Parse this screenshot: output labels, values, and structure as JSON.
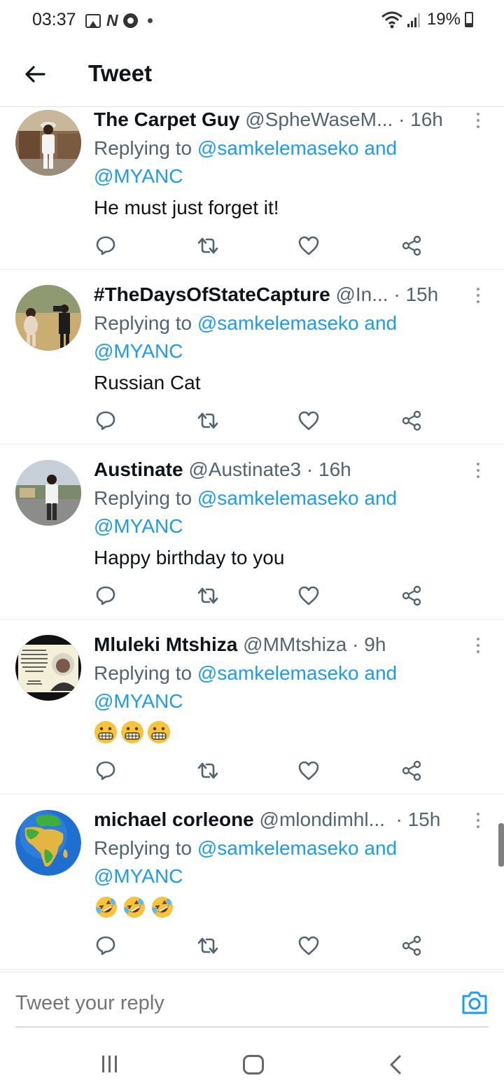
{
  "status_bar": {
    "time": "03:37",
    "battery": "19%",
    "icons_left": [
      "gallery-icon",
      "n-app-icon",
      "chrome-icon",
      "dot-icon"
    ],
    "icons_right": [
      "wifi-icon",
      "signal-icon",
      "battery-icon"
    ]
  },
  "header": {
    "title": "Tweet",
    "back_icon": "arrow-left-icon"
  },
  "colors": {
    "link": "#1d9bf0",
    "text_primary": "#0f1419",
    "text_secondary": "#536471",
    "divider": "#e6ecf0"
  },
  "replies": [
    {
      "name": "The Carpet Guy",
      "handle": "@SpheWaseM...",
      "time": "· 16h",
      "replying_prefix": "Replying to",
      "mention1": "@samkelemaseko",
      "and": "and",
      "mention2": "@MYANC",
      "text": "He must just forget it!",
      "emojis": []
    },
    {
      "name": "#TheDaysOfStateCapture",
      "handle": "@In...",
      "time": "· 15h",
      "replying_prefix": "Replying to",
      "mention1": "@samkelemaseko",
      "and": "and",
      "mention2": "@MYANC",
      "text": "Russian Cat",
      "emojis": []
    },
    {
      "name": "Austinate",
      "handle": "@Austinate3",
      "time": "· 16h",
      "replying_prefix": "Replying to",
      "mention1": "@samkelemaseko",
      "and": "and",
      "mention2": "@MYANC",
      "text": "Happy birthday to you",
      "emojis": []
    },
    {
      "name": "Mluleki Mtshiza",
      "handle": "@MMtshiza",
      "time": "· 9h",
      "replying_prefix": "Replying to",
      "mention1": "@samkelemaseko",
      "and": "and",
      "mention2": "@MYANC",
      "text": "",
      "emojis": [
        "grimacing-face-emoji",
        "grimacing-face-emoji",
        "grimacing-face-emoji"
      ]
    },
    {
      "name": "michael corleone",
      "handle": "@mlondimhl...",
      "time": "· 15h",
      "replying_prefix": "Replying to",
      "mention1": "@samkelemaseko",
      "and": "and",
      "mention2": "@MYANC",
      "text": "",
      "emojis": [
        "rolling-laughing-emoji",
        "rolling-laughing-emoji",
        "rolling-laughing-emoji"
      ]
    }
  ],
  "action_icons": [
    "reply-icon",
    "retweet-icon",
    "like-icon",
    "share-icon"
  ],
  "reply_bar": {
    "placeholder": "Tweet your reply",
    "camera_icon": "camera-icon"
  },
  "nav_bar": {
    "icons": [
      "recent-apps-icon",
      "home-icon",
      "back-icon"
    ]
  }
}
